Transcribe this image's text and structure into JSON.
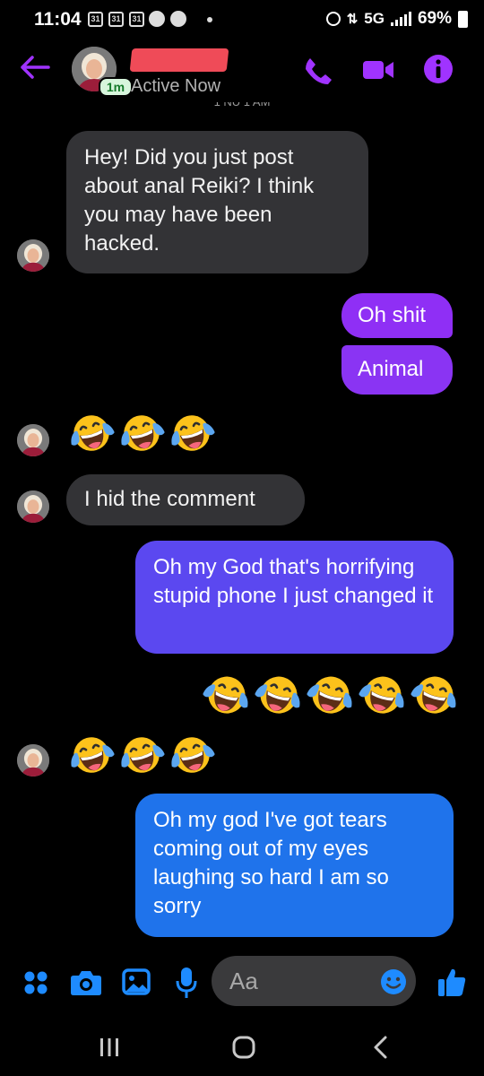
{
  "status_bar": {
    "time": "11:04",
    "calendar_day": "31",
    "network": "5G",
    "battery": "69%"
  },
  "header": {
    "active_badge": "1m",
    "status": "Active Now",
    "cut_off_text": "1 NU 1 AM"
  },
  "messages": [
    {
      "type": "incoming",
      "text": "Hey! Did you just post about anal Reiki? I think you may have been hacked."
    },
    {
      "type": "outgoing",
      "text": "Oh shit"
    },
    {
      "type": "outgoing",
      "text": "Animal"
    },
    {
      "type": "incoming_emoji",
      "emoji": "face-with-tears-of-joy",
      "count": 3
    },
    {
      "type": "incoming",
      "text": "I hid the comment"
    },
    {
      "type": "outgoing",
      "text": "Oh my God that's horrifying stupid phone I just changed it"
    },
    {
      "type": "outgoing_emoji",
      "emoji": "face-with-tears-of-joy",
      "count": 5
    },
    {
      "type": "incoming_emoji",
      "emoji": "face-with-tears-of-joy",
      "count": 3
    },
    {
      "type": "outgoing",
      "text": "Oh my god I've got tears coming out of my eyes laughing so hard I am so sorry"
    }
  ],
  "composer": {
    "placeholder": "Aa",
    "icons": [
      "menu-dots-icon",
      "camera-icon",
      "gallery-icon",
      "microphone-icon",
      "emoji-icon",
      "thumbs-up-icon"
    ]
  },
  "colors": {
    "accent": "#a033ff",
    "bubble_incoming": "#333336",
    "bubble_purple": "#8f2ff5",
    "bubble_indigo": "#5b48f0",
    "bubble_blue": "#1f73eb",
    "composer_blue": "#1e8bff"
  },
  "nav_bar": {
    "buttons": [
      "recent-apps-button",
      "home-button",
      "back-button"
    ]
  }
}
